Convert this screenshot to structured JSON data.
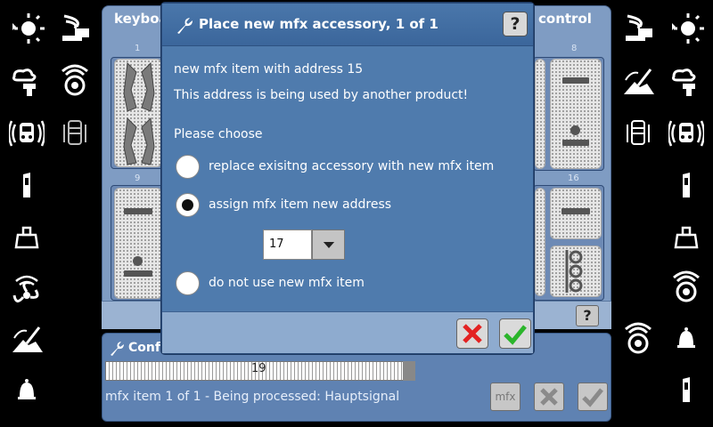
{
  "background": {
    "keyboard_title_left": "keyboa",
    "keyboard_title_right": "control",
    "column_numbers": [
      "1",
      "8",
      "9",
      "16"
    ]
  },
  "dialog": {
    "title": "Place new mfx accessory, 1 of 1",
    "help_label": "?",
    "line1": "new mfx item with address 15",
    "line2": "This address is being used by another product!",
    "prompt": "Please choose",
    "options": [
      {
        "label": "replace exisitng accessory with new mfx item",
        "selected": false
      },
      {
        "label": "assign mfx item new address",
        "selected": true
      },
      {
        "label": "do not use new mfx item",
        "selected": false
      }
    ],
    "address_value": "17"
  },
  "config": {
    "title": "Confi",
    "progress_value": "19",
    "progress_fraction": 0.96,
    "status": "mfx item 1 of 1 - Being processed: Hauptsignal",
    "mfx_button_label": "mfx"
  },
  "help_mini_label": "?",
  "colors": {
    "dialog_bg": "#4f7bad",
    "panel_bg": "#7f9cc3",
    "cancel_red": "#e32222",
    "ok_green": "#2bb52b"
  },
  "icons": {
    "left": [
      "light-icon",
      "function-decoder-icon",
      "smoke-icon",
      "sound-icon",
      "train-radio-icon",
      "rail-icon",
      "weight-icon",
      "fan-icon",
      "shovel-icon",
      "bell-icon"
    ],
    "right": [
      "function-decoder-icon",
      "light-icon",
      "shovel-icon",
      "smoke-icon",
      "train-icon",
      "train-radio-icon",
      "rail-icon",
      "weight-icon",
      "sound-icon",
      "bell-icon"
    ]
  }
}
